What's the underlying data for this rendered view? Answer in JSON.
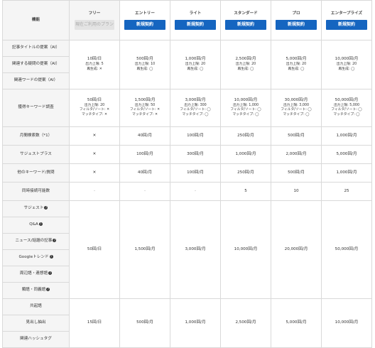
{
  "header": {
    "feature_label": "機能",
    "plans": [
      {
        "name": "フリー",
        "button": "現在ご利用のプラン",
        "current": true
      },
      {
        "name": "エントリー",
        "button": "新規契約",
        "current": false
      },
      {
        "name": "ライト",
        "button": "新規契約",
        "current": false
      },
      {
        "name": "スタンダード",
        "button": "新規契約",
        "current": false
      },
      {
        "name": "プロ",
        "button": "新規契約",
        "current": false
      },
      {
        "name": "エンタープライズ",
        "button": "新規契約",
        "current": false
      }
    ]
  },
  "ai_group": {
    "features": [
      "記事タイトルの提案（AI）",
      "関連する疑問の提案（AI）",
      "関連ワードの提案（AI）"
    ],
    "cells": [
      {
        "main": "10回/日",
        "limit": "出力上限: 5",
        "regen": "再生成: ✕"
      },
      {
        "main": "500回/月",
        "limit": "出力上限: 10",
        "regen": "再生成: ◯"
      },
      {
        "main": "1,000回/月",
        "limit": "出力上限: 20",
        "regen": "再生成: ◯"
      },
      {
        "main": "2,500回/月",
        "limit": "出力上限: 20",
        "regen": "再生成: ◯"
      },
      {
        "main": "5,000回/月",
        "limit": "出力上限: 20",
        "regen": "再生成: ◯"
      },
      {
        "main": "10,000回/月",
        "limit": "出力上限: 20",
        "regen": "再生成: ◯"
      }
    ]
  },
  "kw_research": {
    "feature": "獲得キーワード調査",
    "cells": [
      {
        "main": "50回/日",
        "limit": "出力上限: 20",
        "filter": "フィルタ/ソート: ✕",
        "match": "マッチタイプ: ✕"
      },
      {
        "main": "1,500回/月",
        "limit": "出力上限: 50",
        "filter": "フィルタ/ソート: ✕",
        "match": "マッチタイプ: ✕"
      },
      {
        "main": "3,000回/月",
        "limit": "出力上限: 300",
        "filter": "フィルタ/ソート: ◯",
        "match": "マッチタイプ: ◯"
      },
      {
        "main": "10,000回/月",
        "limit": "出力上限: 1,000",
        "filter": "フィルタ/ソート: ◯",
        "match": "マッチタイプ: ◯"
      },
      {
        "main": "30,000回/月",
        "limit": "出力上限: 3,000",
        "filter": "フィルタ/ソート: ◯",
        "match": "マッチタイプ: ◯"
      },
      {
        "main": "50,000回/月",
        "limit": "出力上限: 5,000",
        "filter": "フィルタ/ソート: ◯",
        "match": "マッチタイプ: ◯"
      }
    ]
  },
  "simple_rows": [
    {
      "feature": "月間検索数（*1）",
      "values": [
        "✕",
        "40回/月",
        "100回/月",
        "250回/月",
        "500回/月",
        "1,000回/月"
      ]
    },
    {
      "feature": "サジェストプラス",
      "values": [
        "✕",
        "100回/月",
        "300回/月",
        "1,000回/月",
        "2,000回/月",
        "5,000回/月"
      ]
    },
    {
      "feature": "他のキーワード/質問",
      "values": [
        "✕",
        "40回/月",
        "100回/月",
        "250回/月",
        "500回/月",
        "1,000回/月"
      ]
    },
    {
      "feature": "同時接続可能数",
      "values": [
        "-",
        "-",
        "-",
        "5",
        "10",
        "25"
      ]
    }
  ],
  "suggest_group": {
    "features": [
      "サジェスト",
      "Q&A",
      "ニュース/話題の記事",
      "Googleトレンド",
      "周辺語・連想語",
      "類語・同義語"
    ],
    "values": [
      "50回/日",
      "1,500回/月",
      "3,000回/月",
      "10,000回/月",
      "20,000回/月",
      "50,000回/月"
    ]
  },
  "cooccur_group": {
    "features": [
      "共起語",
      "見出し抽出",
      "関連ハッシュタグ"
    ],
    "values": [
      "15回/日",
      "500回/月",
      "1,000回/月",
      "2,500回/月",
      "5,000回/月",
      "10,000回/月"
    ]
  },
  "help_icon": "question-circle-icon"
}
